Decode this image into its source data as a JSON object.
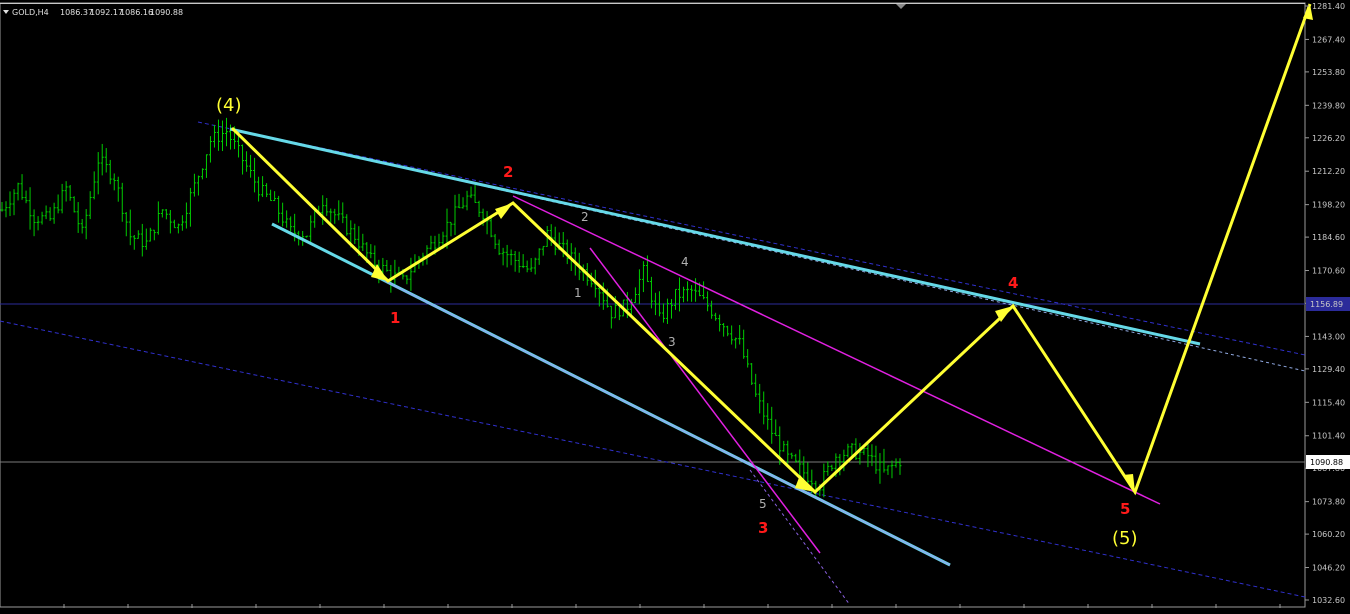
{
  "header": {
    "symbol": "GOLD,H4",
    "open": "1086.37",
    "high": "1092.17",
    "low": "1086.16",
    "close": "1090.88"
  },
  "price_axis": {
    "ticks": [
      "1281.40",
      "1267.40",
      "1253.80",
      "1239.80",
      "1226.20",
      "1212.20",
      "1198.20",
      "1184.60",
      "1170.60",
      "1156.89",
      "1143.00",
      "1129.40",
      "1115.40",
      "1101.40",
      "1087.80",
      "1073.80",
      "1060.20",
      "1046.20",
      "1032.60"
    ],
    "current_price": "1090.88",
    "hline_price": "1156.89"
  },
  "wave_labels": {
    "w4_major": "(4)",
    "w5_major": "(5)",
    "w1": "1",
    "w2": "2",
    "w3": "3",
    "w4": "4",
    "w5": "5",
    "s1": "1",
    "s2": "2",
    "s3": "3",
    "s4": "4",
    "s5": "5"
  },
  "colors": {
    "bars": "#00cc00",
    "arrows": "#ffff33",
    "cyan_channel": "#66d9e8",
    "magenta_channel": "#e020e0",
    "dashed_blue": "#3030cc",
    "hline": "#2b2b9a",
    "red_label": "#ff1a1a"
  },
  "chart_data": {
    "type": "line",
    "title": "GOLD,H4",
    "price_range": [
      1032.6,
      1281.4
    ],
    "wave_path_prices": [
      1229,
      1166,
      1201,
      1080,
      1157,
      1078,
      1284
    ],
    "price_samples": [
      1196,
      1206,
      1193,
      1192,
      1205,
      1186,
      1217,
      1210,
      1185,
      1182,
      1196,
      1189,
      1206,
      1225,
      1229,
      1217,
      1205,
      1198,
      1187,
      1186,
      1200,
      1192,
      1185,
      1175,
      1170,
      1166,
      1176,
      1183,
      1192,
      1201,
      1195,
      1180,
      1175,
      1170,
      1186,
      1179,
      1172,
      1166,
      1153,
      1156,
      1170,
      1150,
      1160,
      1162,
      1156,
      1148,
      1140,
      1118,
      1103,
      1092,
      1086,
      1081,
      1093,
      1095,
      1093,
      1086,
      1091
    ]
  }
}
